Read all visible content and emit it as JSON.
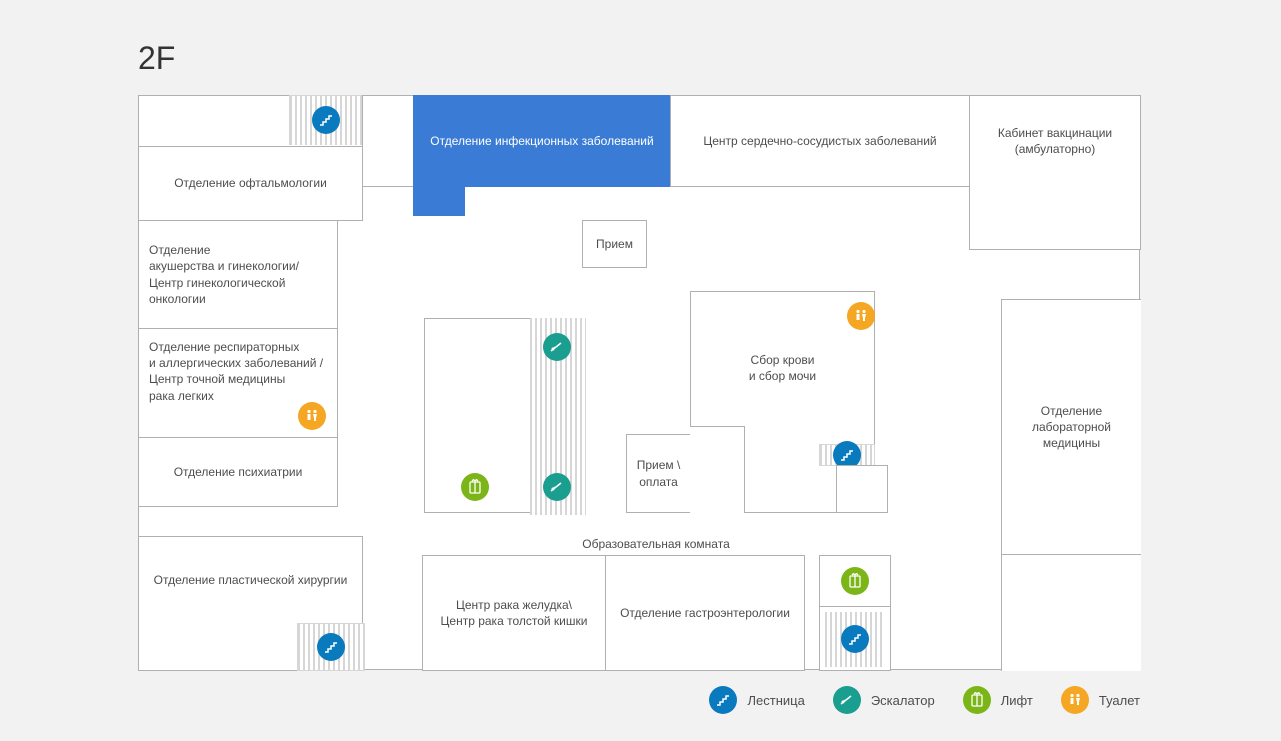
{
  "floor_label": "2F",
  "rooms": {
    "ophthalmology": "Отделение офтальмологии",
    "infectious": "Отделение инфекционных заболеваний",
    "cardio": "Центр сердечно-сосудистых заболеваний",
    "vaccination": "Кабинет вакцинации (амбулаторно)",
    "obgyn": "Отделение\nакушерства и гинекологии/\nЦентр гинекологической\nонкологии",
    "respiratory": "Отделение респираторных\nи аллергических заболеваний /\nЦентр точной медицины\nрака легких",
    "psychiatry": "Отделение психиатрии",
    "plastic": "Отделение пластической хирургии",
    "reception": "Прием",
    "reception_pay": "Прием \\\nоплата",
    "blood": "Сбор крови\nи сбор мочи",
    "education": "Образовательная комната",
    "stomach": "Центр рака желудка\\\nЦентр рака толстой кишки",
    "gastro": "Отделение гастроэнтерологии",
    "lab": "Отделение\nлабораторной медицины"
  },
  "legend": {
    "stairs": "Лестница",
    "escalator": "Эскалатор",
    "elevator": "Лифт",
    "toilet": "Туалет"
  },
  "colors": {
    "highlight": "#3a7bd5",
    "stairs": "#0a7abf",
    "escalator": "#1a9e8f",
    "elevator": "#7cb518",
    "toilet": "#f5a623"
  }
}
